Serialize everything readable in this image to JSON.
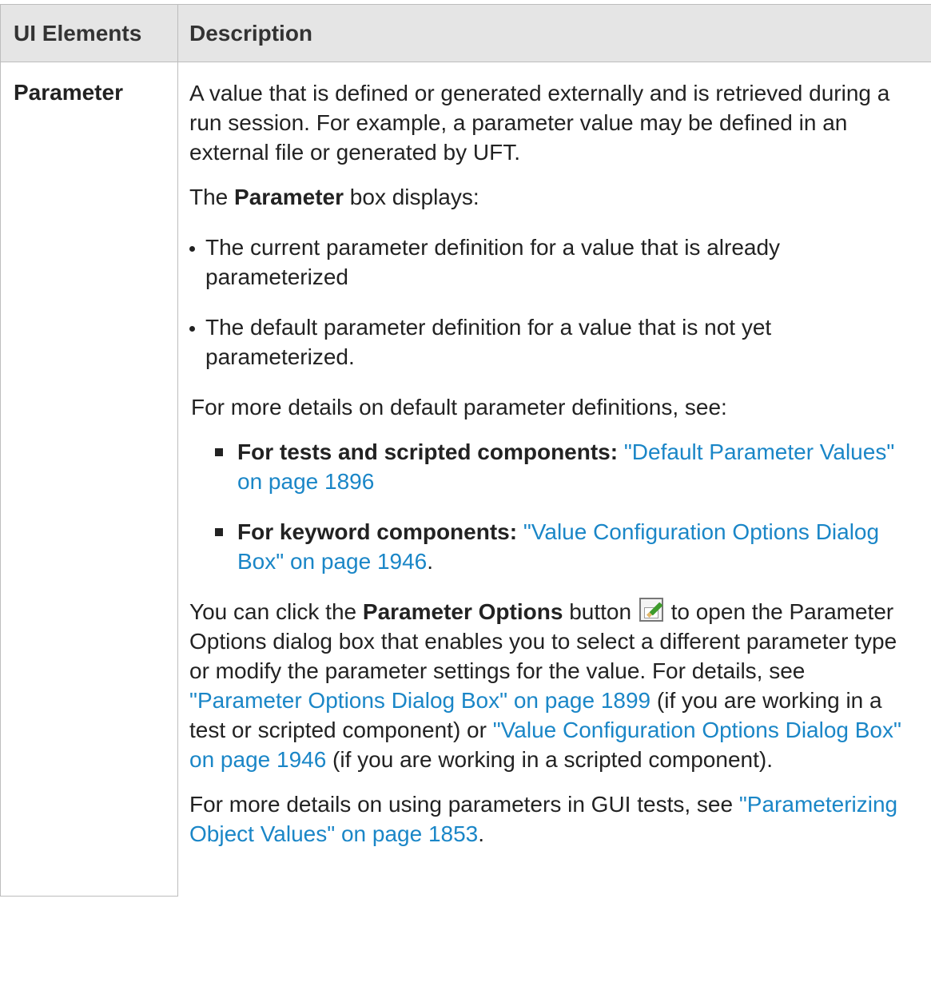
{
  "table": {
    "headers": {
      "ui_elements": "UI Elements",
      "description": "Description"
    },
    "row": {
      "element": "Parameter",
      "intro": "A value that is defined or generated externally and is retrieved during a run session. For example, a parameter value may be defined in an external file or generated by UFT.",
      "box_line": {
        "prefix": "The ",
        "bold": "Parameter",
        "suffix": " box displays:"
      },
      "dot_items": [
        "The current parameter definition for a value that is already parameterized",
        "The default parameter definition for a value that is not yet parameterized."
      ],
      "defaults_intro": "For more details on default parameter definitions, see:",
      "square_items": [
        {
          "bold": "For tests and scripted components:",
          "link": "\"Default Parameter Values\" on page 1896",
          "after": ""
        },
        {
          "bold": "For keyword components:",
          "link": "\"Value Configuration Options Dialog Box\" on page 1946",
          "after": "."
        }
      ],
      "options_para": {
        "t1": "You can click the ",
        "bold": "Parameter Options",
        "t2": " button ",
        "icon": "parameter-options-icon",
        "t3": " to open the Parameter Options dialog box that enables you to select a different parameter type or modify the parameter settings for the value. For details, see ",
        "link1": "\"Parameter Options Dialog Box\" on page 1899",
        "t4": " (if you are working in a test or scripted component) or ",
        "link2": "\"Value Configuration Options Dialog Box\" on page 1946",
        "t5": " (if you are working in a scripted component)."
      },
      "gui_para": {
        "t1": "For more details on using parameters in GUI tests, see ",
        "link": "\"Parameterizing Object Values\" on page 1853",
        "t2": "."
      }
    }
  },
  "colors": {
    "link": "#1a86c7",
    "header_bg": "#e5e5e5",
    "border": "#bdbdbd",
    "text": "#222222"
  }
}
